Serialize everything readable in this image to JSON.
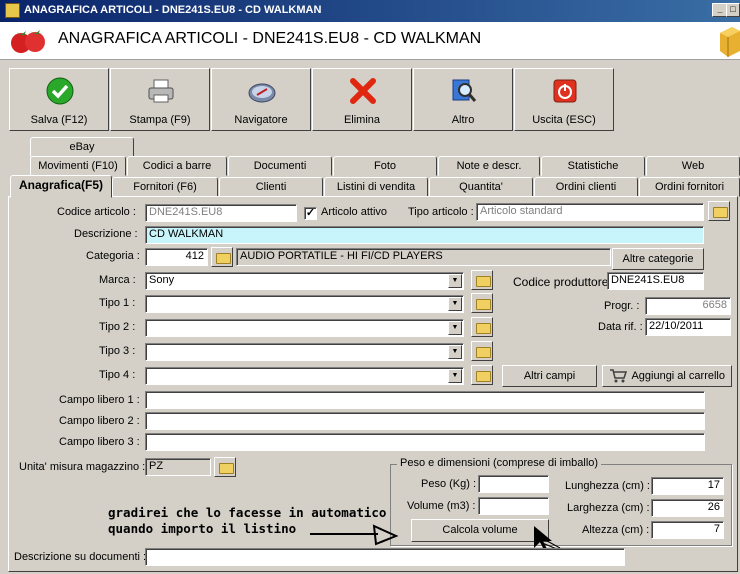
{
  "window": {
    "title": "ANAGRAFICA ARTICOLI - DNE241S.EU8 - CD WALKMAN",
    "header_title": "ANAGRAFICA ARTICOLI - DNE241S.EU8 - CD WALKMAN",
    "controls": {
      "minimize": "_",
      "maximize": "□"
    }
  },
  "toolbar": [
    {
      "label": "Salva (F12)",
      "icon": "checkmark-icon"
    },
    {
      "label": "Stampa (F9)",
      "icon": "printer-icon"
    },
    {
      "label": "Navigatore",
      "icon": "compass-icon"
    },
    {
      "label": "Elimina",
      "icon": "delete-x-icon"
    },
    {
      "label": "Altro",
      "icon": "magnifier-icon"
    },
    {
      "label": "Uscita (ESC)",
      "icon": "power-icon"
    }
  ],
  "tabs": {
    "row1": [
      "eBay"
    ],
    "row2": [
      "Movimenti (F10)",
      "Codici a barre",
      "Documenti",
      "Foto",
      "Note e descr.",
      "Statistiche",
      "Web"
    ],
    "row3": [
      "Anagrafica(F5)",
      "Fornitori (F6)",
      "Clienti",
      "Listini di vendita",
      "Quantita'",
      "Ordini clienti",
      "Ordini fornitori"
    ],
    "active": "Anagrafica(F5)"
  },
  "form": {
    "codice_articolo": {
      "label": "Codice articolo :",
      "value": "DNE241S.EU8"
    },
    "articolo_attivo": {
      "label": "Articolo attivo",
      "checked": "✓"
    },
    "tipo_articolo": {
      "label": "Tipo articolo :",
      "value": "Articolo standard"
    },
    "descrizione": {
      "label": "Descrizione :",
      "value": "CD WALKMAN"
    },
    "categoria": {
      "label": "Categoria :",
      "code": "412",
      "name": "AUDIO PORTATILE - HI FI/CD PLAYERS",
      "button": "Altre categorie"
    },
    "marca": {
      "label": "Marca :",
      "value": "Sony"
    },
    "codice_produttore": {
      "label": "Codice produttore :",
      "value": "DNE241S.EU8"
    },
    "tipo1": {
      "label": "Tipo 1 :",
      "value": ""
    },
    "tipo2": {
      "label": "Tipo 2 :",
      "value": ""
    },
    "tipo3": {
      "label": "Tipo 3 :",
      "value": ""
    },
    "tipo4": {
      "label": "Tipo 4 :",
      "value": ""
    },
    "progr": {
      "label": "Progr. :",
      "value": "6658"
    },
    "data_rif": {
      "label": "Data rif. :",
      "value": "22/10/2011"
    },
    "altri_campi": "Altri campi",
    "aggiungi_carrello": "Aggiungi al carrello",
    "campo_libero_1": {
      "label": "Campo libero 1 :",
      "value": ""
    },
    "campo_libero_2": {
      "label": "Campo libero 2 :",
      "value": ""
    },
    "campo_libero_3": {
      "label": "Campo libero 3 :",
      "value": ""
    },
    "unita_misura": {
      "label": "Unita' misura magazzino :",
      "value": "PZ"
    },
    "descrizione_documenti": {
      "label": "Descrizione su documenti :",
      "value": ""
    }
  },
  "peso_dimensioni": {
    "title": "Peso e dimensioni (comprese di imballo)",
    "peso": {
      "label": "Peso (Kg) :",
      "value": ""
    },
    "volume": {
      "label": "Volume (m3) :",
      "value": ""
    },
    "calcola": "Calcola volume",
    "lunghezza": {
      "label": "Lunghezza (cm) :",
      "value": "17"
    },
    "larghezza": {
      "label": "Larghezza (cm) :",
      "value": "26"
    },
    "altezza": {
      "label": "Altezza (cm) :",
      "value": "7"
    }
  },
  "annotation": {
    "line1": "gradirei che lo facesse in automatico",
    "line2": "quando importo il listino"
  },
  "colors": {
    "titlebar": "#0a246a",
    "description_bg": "#c8f5fb",
    "window_bg": "#d4d0c8"
  }
}
